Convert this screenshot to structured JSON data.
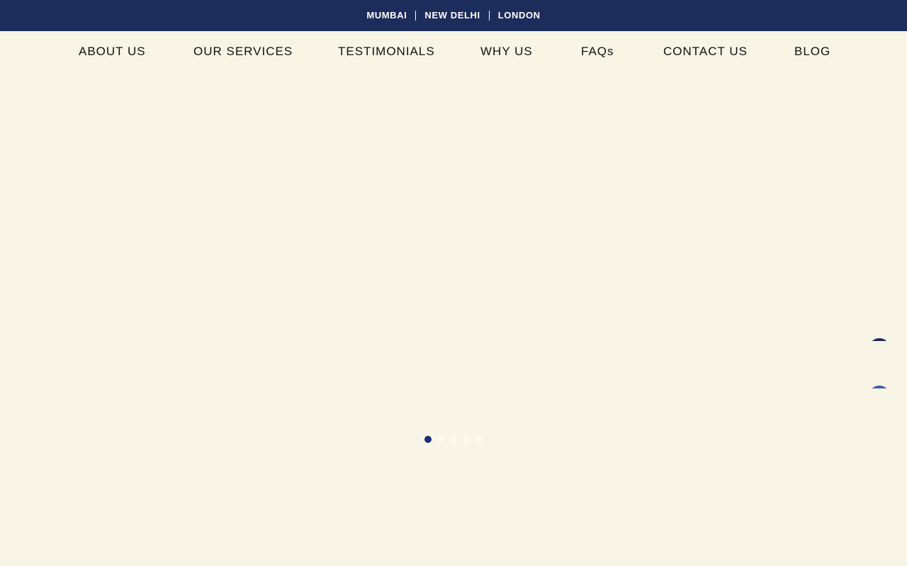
{
  "topbar": {
    "cities": [
      "MUMBAI",
      "NEW DELHI",
      "LONDON"
    ]
  },
  "nav": {
    "items": [
      "ABOUT US",
      "OUR SERVICES",
      "TESTIMONIALS",
      "WHY US",
      "FAQs",
      "CONTACT US",
      "BLOG"
    ]
  },
  "carousel": {
    "slide_count": 5,
    "active_index": 0
  },
  "colors": {
    "topbar_bg": "#1c2c5b",
    "page_bg": "#f8f4e6",
    "dot_active": "#1a2e7a",
    "dot_inactive": "#fbf9f1"
  }
}
